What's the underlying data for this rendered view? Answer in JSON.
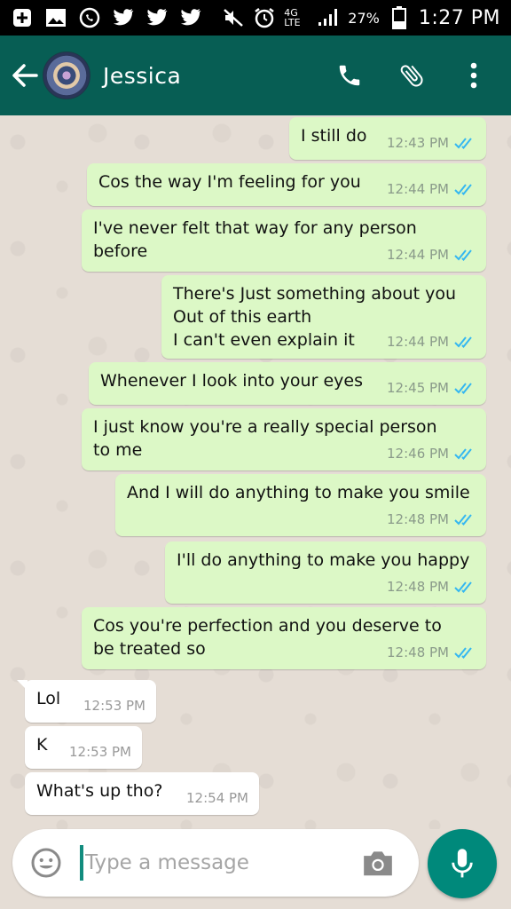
{
  "status_bar": {
    "battery_pct": "27%",
    "time": "1:27 PM",
    "network": "4G LTE"
  },
  "header": {
    "contact_name": "Jessica"
  },
  "messages": [
    {
      "text": "I still do",
      "time": "12:43 PM",
      "dir": "out"
    },
    {
      "text": "Cos the way I'm feeling for you",
      "time": "12:44 PM",
      "dir": "out"
    },
    {
      "text": "I've never felt that way for any person\nbefore",
      "time": "12:44 PM",
      "dir": "out"
    },
    {
      "text": "There's Just something about you\nOut of this earth\nI can't even explain it",
      "time": "12:44 PM",
      "dir": "out"
    },
    {
      "text": "Whenever I look into your eyes",
      "time": "12:45 PM",
      "dir": "out"
    },
    {
      "text": "I just know you're a really special person\nto me",
      "time": "12:46 PM",
      "dir": "out"
    },
    {
      "text": "And I will do anything to make you smile",
      "time": "12:48 PM",
      "dir": "out"
    },
    {
      "text": "I'll do anything to make you happy",
      "time": "12:48 PM",
      "dir": "out"
    },
    {
      "text": "Cos you're perfection and you deserve to\nbe treated so",
      "time": "12:48 PM",
      "dir": "out"
    },
    {
      "text": "Lol",
      "time": "12:53 PM",
      "dir": "in"
    },
    {
      "text": "K",
      "time": "12:53 PM",
      "dir": "in"
    },
    {
      "text": "What's up tho?",
      "time": "12:54 PM",
      "dir": "in"
    }
  ],
  "composer": {
    "placeholder": "Type a message"
  },
  "colors": {
    "header": "#075e54",
    "outgoing_bubble": "#dcf8c6",
    "read_tick": "#34b7f1",
    "mic_button": "#00897b"
  }
}
